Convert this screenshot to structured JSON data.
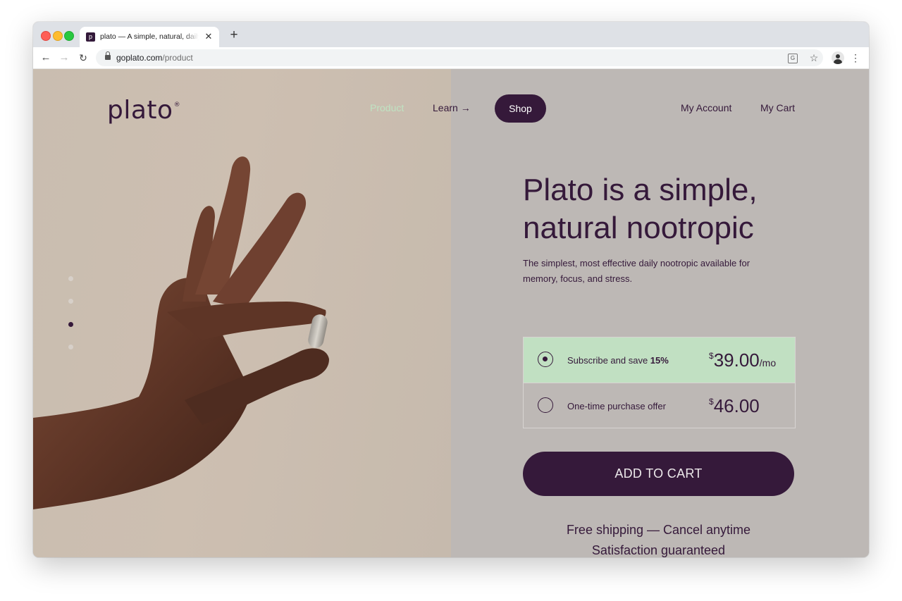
{
  "browser": {
    "tab_favicon": "p",
    "tab_title": "plato — A simple, natural, daily nootropic",
    "tab_close": "✕",
    "new_tab": "+",
    "url_domain": "goplato.com",
    "url_path": "/product",
    "icons": [
      "back-icon",
      "forward-icon",
      "reload-icon",
      "lock-icon",
      "translate-icon",
      "star-icon",
      "profile-avatar",
      "menu-icon"
    ]
  },
  "site": {
    "logo": "plato",
    "logo_mark": "®",
    "nav": {
      "product": "Product",
      "learn": "Learn →",
      "shop": "Shop",
      "account": "My Account",
      "cart": "My Cart"
    },
    "carousel": {
      "dots": 4,
      "active_index": 2
    }
  },
  "product": {
    "headline": "Plato is a simple, natural nootropic",
    "description": "The simplest, most effective daily nootropic available for memory, focus, and stress.",
    "options": [
      {
        "label_prefix": "Subscribe and save ",
        "label_bold": "15%",
        "currency": "$",
        "price": "39.00",
        "period": "/mo",
        "selected": true
      },
      {
        "label_prefix": "One-time purchase offer",
        "label_bold": "",
        "currency": "$",
        "price": "46.00",
        "period": "",
        "selected": false
      }
    ],
    "add_to_cart": "ADD TO CART",
    "perks": [
      "Free shipping — Cancel anytime",
      "Satisfaction guaranteed"
    ]
  },
  "colors": {
    "brand_purple": "#35193a",
    "subscribe_green": "#c1e0c2",
    "panel_gray": "#bdb8b5",
    "hero_beige": "#cdbfb1",
    "nav_active_green": "#bfe3c2"
  }
}
